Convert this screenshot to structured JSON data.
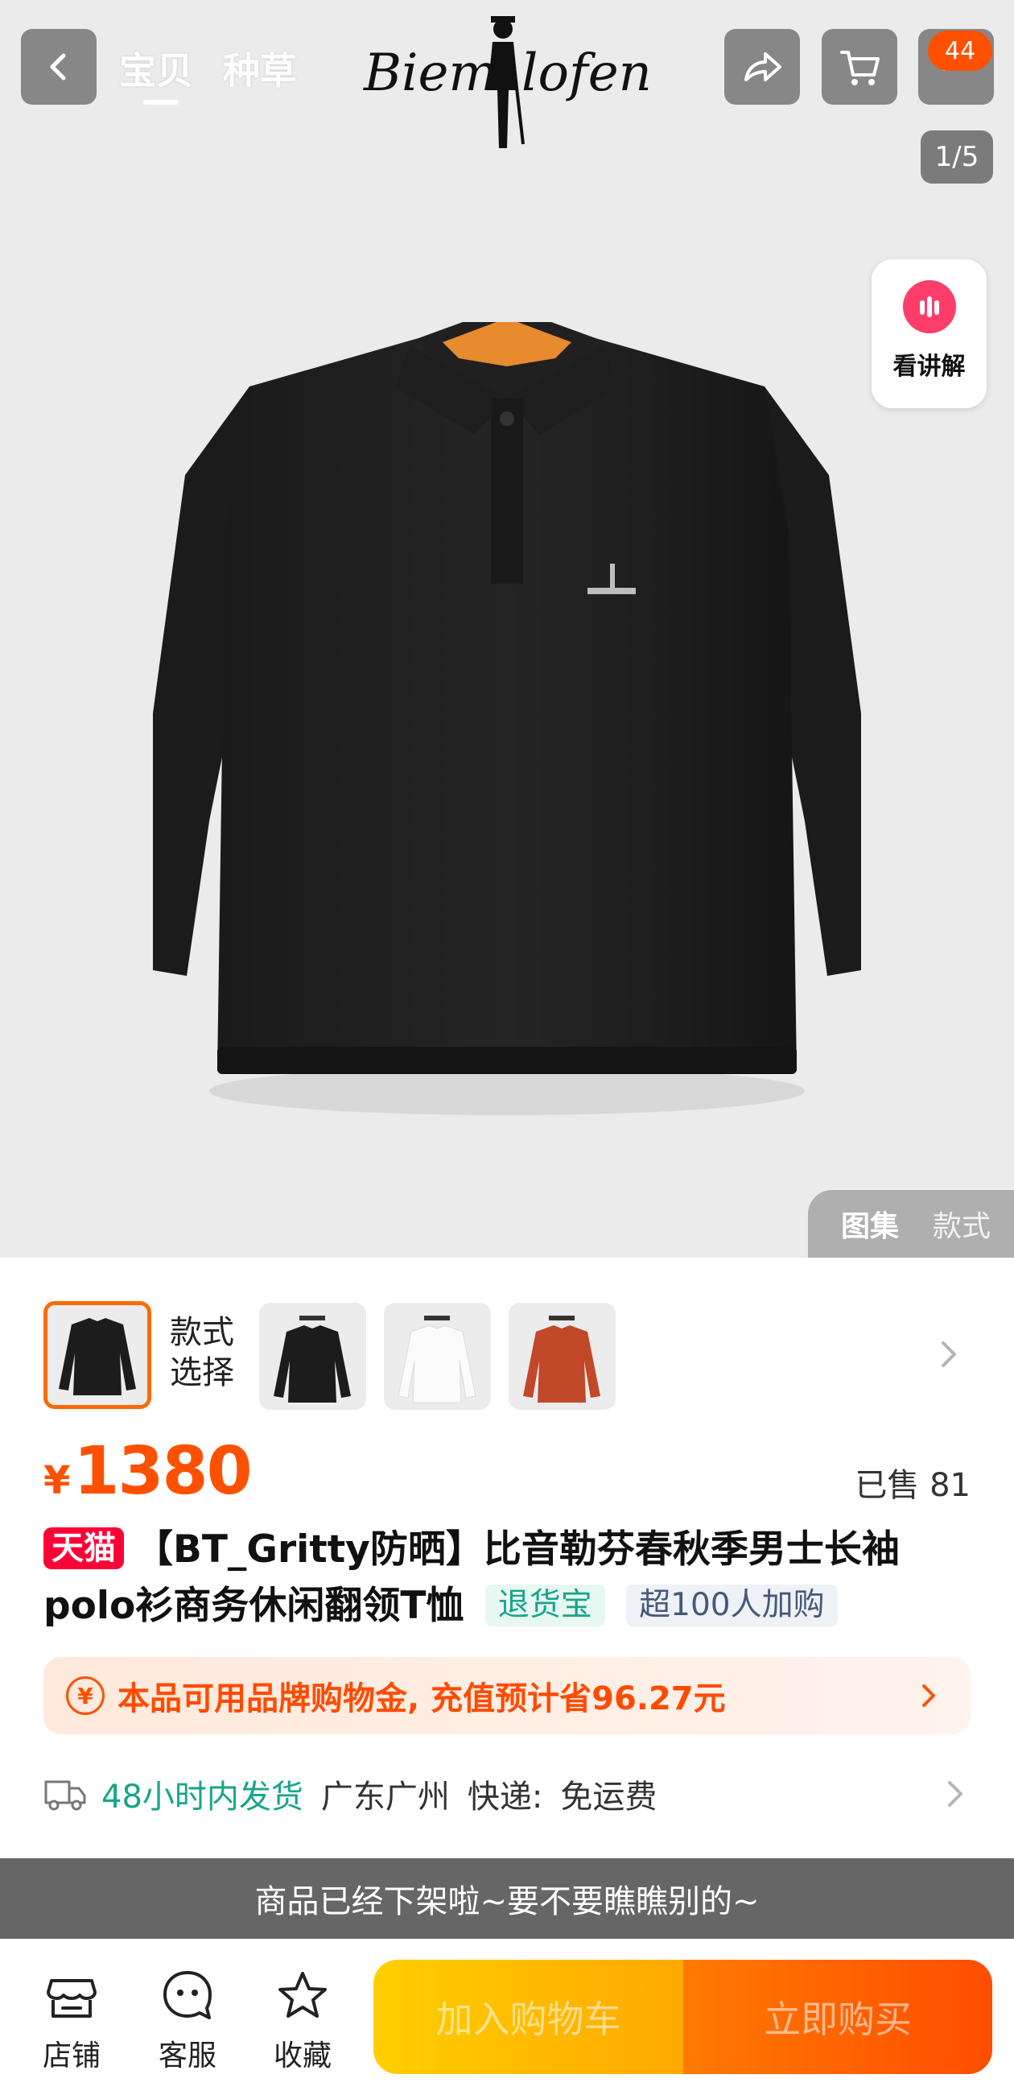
{
  "header": {
    "tabs": [
      {
        "label": "宝贝",
        "active": true
      },
      {
        "label": "种草",
        "active": false
      }
    ],
    "brand_logo_text": "Biemlofen",
    "cart_badge": "44",
    "pager": "1/5",
    "explain_label": "看讲解"
  },
  "gallery_switch": {
    "active": "图集",
    "inactive": "款式"
  },
  "variants": {
    "label": "款式选择",
    "thumbnails": [
      {
        "name": "black-polo",
        "color": "#1c1c1c",
        "selected": true
      },
      {
        "name": "black-polo-alt",
        "color": "#1c1c1c",
        "selected": false
      },
      {
        "name": "white-polo",
        "color": "#f4f4f4",
        "selected": false
      },
      {
        "name": "orange-polo",
        "color": "#c2482a",
        "selected": false
      }
    ]
  },
  "price": {
    "currency": "¥",
    "value": "1380",
    "sold": "已售 81"
  },
  "product": {
    "platform_badge": "天猫",
    "title": "【BT_Gritty防晒】比音勒芬春秋季男士长袖polo衫商务休闲翻领T恤",
    "tags": [
      "退货宝",
      "超100人加购"
    ]
  },
  "promo": {
    "icon": "yen-circle-icon",
    "text": "本品可用品牌购物金, 充值预计省96.27元"
  },
  "shipping": {
    "time": "48小时内发货",
    "location": "广东广州",
    "carrier_label": "快递:",
    "fee": "免运费"
  },
  "notice": "商品已经下架啦~要不要瞧瞧别的~",
  "bottom_bar": {
    "shop": "店铺",
    "service": "客服",
    "favorite": "收藏",
    "add_to_cart": "加入购物车",
    "buy_now": "立即购买"
  },
  "colors": {
    "accent": "#ff5000",
    "tmall": "#ff0036",
    "green": "#18a58a"
  }
}
